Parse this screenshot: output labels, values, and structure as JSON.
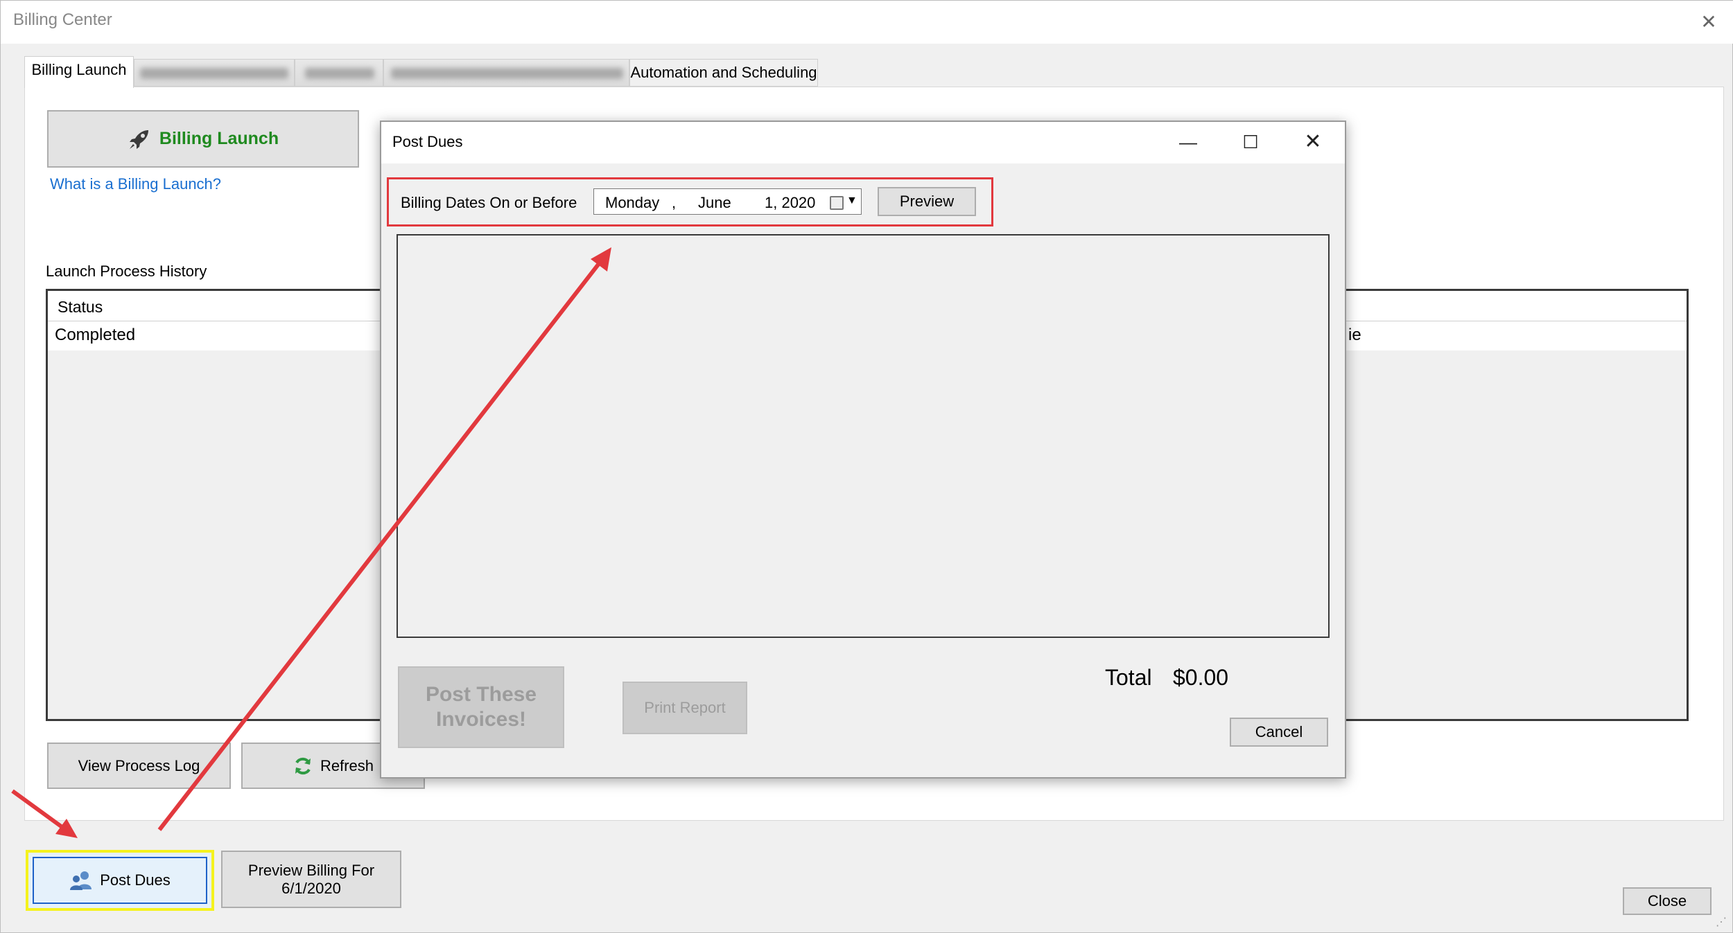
{
  "window": {
    "title": "Billing Center",
    "close_glyph": "✕"
  },
  "tabs": [
    {
      "label": "Billing Launch"
    },
    {
      "label": "Automation and Scheduling"
    }
  ],
  "billing_launch": {
    "button_label": "Billing Launch",
    "icon": "rocket-icon",
    "help_link": "What is a Billing Launch?",
    "history_label": "Launch Process History",
    "grid": {
      "columns": [
        "Status"
      ],
      "rows": [
        {
          "status": "Completed",
          "right_fragment": "ie"
        }
      ]
    },
    "view_log_label": "View Process Log",
    "refresh_label": "Refresh"
  },
  "bottom": {
    "post_dues_label": "Post Dues",
    "preview_billing_line1": "Preview Billing For",
    "preview_billing_line2": "6/1/2020",
    "close_label": "Close"
  },
  "dialog": {
    "title": "Post Dues",
    "minimize_glyph": "—",
    "maximize_glyph": "☐",
    "close_glyph": "✕",
    "date_label": "Billing Dates On or Before",
    "date": {
      "weekday": "Monday",
      "comma": ",",
      "month": "June",
      "day_year": "1, 2020"
    },
    "preview_label": "Preview",
    "post_invoices_line1": "Post These",
    "post_invoices_line2": "Invoices!",
    "print_report_label": "Print Report",
    "total_label": "Total",
    "total_value": "$0.00",
    "cancel_label": "Cancel"
  },
  "colors": {
    "accent_green": "#1f8a1f",
    "link_blue": "#1a6fd0",
    "annotation_red": "#e2393e",
    "highlight_yellow": "#f5f21e"
  }
}
